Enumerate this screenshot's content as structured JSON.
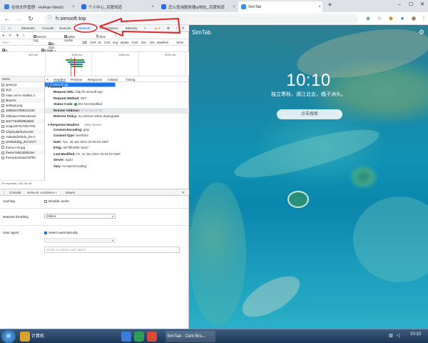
{
  "tabs": [
    {
      "title": "在线文件管理 - HoRain-WebS",
      "favicon_color": "#3f7fd6"
    },
    {
      "title": "个人中心_百度知道",
      "favicon_color": "#2f6ce0"
    },
    {
      "title": "怎么查询服务器ip地址_百度知道",
      "favicon_color": "#2f6ce0"
    },
    {
      "title": "SimTab",
      "favicon_color": "#3a8fd8"
    }
  ],
  "address": {
    "url": "h.simsoft.top"
  },
  "devtools": {
    "tabs": [
      "Elements",
      "Console",
      "Sources",
      "Network",
      "Performance",
      "Memory",
      "»"
    ],
    "warn_count": "▲ 5",
    "toolbar": {
      "preserve_log": "Preserve log",
      "disable_cache": "Disable cache",
      "online": "Online"
    },
    "filter": {
      "placeholder": "Filter",
      "hide_data_urls": "Hide data URLs",
      "types": [
        "All",
        "XHR",
        "JS",
        "CSS",
        "Img",
        "Media",
        "Font",
        "Doc",
        "WS",
        "Manifest",
        "Other"
      ]
    },
    "filter2": {
      "blocked_cookies": "Has blocked cookies",
      "blocked_requests": "Blocked Requests"
    },
    "overview_ticks": [
      "500 ms",
      "1000 ms",
      "1500 ms",
      "2000 ms"
    ],
    "request_list": {
      "header": "Name",
      "rows": [
        "h.simsoft.top",
        "jquery.js",
        "ui.js",
        "main.css?v=stable1.2",
        "bluecss",
        "settings.png",
        "180b84478b8e12183",
        "33b2aee4754ec5ca42",
        "a0e774c6fa06ba56d",
        "images9?0v7d4e7e9c",
        "Chipmunk/fLZH-CN/",
        "YoMarkd/Shido_ZH-C",
        "UIVBuilding_ZH-CN77",
        "theme.min.jpg",
        "theme?a041d5022ee",
        "themeae162aa7af7bb"
      ],
      "selected": 0,
      "status": "29 requests | 281.98 kB"
    },
    "detail_tabs": [
      "Headers",
      "Preview",
      "Response",
      "Initiator",
      "Timing"
    ],
    "general": {
      "title": "▾ General",
      "request_url_k": "Request URL:",
      "request_url_v": "http://h.simsoft.top/",
      "method_k": "Request Method:",
      "method_v": "GET",
      "status_k": "Status Code:",
      "status_v": "304 Not Modified",
      "remote_k": "Remote Address:",
      "remote_v": "27.54.54.67:80",
      "referrer_k": "Referrer Policy:",
      "referrer_v": "no-referrer-when-downgrade"
    },
    "response_headers": {
      "title": "▾ Response Headers",
      "view_source": "view source",
      "items": [
        {
          "k": "Content-Encoding:",
          "v": "gzip"
        },
        {
          "k": "Content-Type:",
          "v": "text/html"
        },
        {
          "k": "Date:",
          "v": "Tue, 26 Jan 2021 02:06:54 GMT"
        },
        {
          "k": "ETag:",
          "v": "W/\"5ffc59f2-1bc6\""
        },
        {
          "k": "Last-Modified:",
          "v": "Fri, 11 Jan 2021 04:52:02 GMT"
        },
        {
          "k": "Server:",
          "v": "nginx"
        },
        {
          "k": "Vary:",
          "v": "Accept-Encoding"
        }
      ]
    },
    "drawer_tabs": [
      "Console",
      "Network conditions ×",
      "Issues"
    ],
    "netcond": {
      "caching_label": "Caching",
      "caching_value": "Disable cache",
      "throttle_label": "Network throttling",
      "throttle_value": "Online",
      "ua_label": "User agent",
      "ua_auto": "Select automatically",
      "ua_placeholder": "Enter a custom user agent"
    }
  },
  "page": {
    "brand": "SimTab",
    "time": "10:10",
    "quote": "独立寒秋，湘江北去，橘子洲头。",
    "search_button": "点击搜索"
  },
  "taskbar": {
    "start": "⊞",
    "computer_label": "计算机",
    "chrome_label": "SimTab - Cent Bro...",
    "clock": "10:10"
  },
  "colors": {
    "accent": "#1a73e8",
    "annotation": "#e0282d"
  }
}
